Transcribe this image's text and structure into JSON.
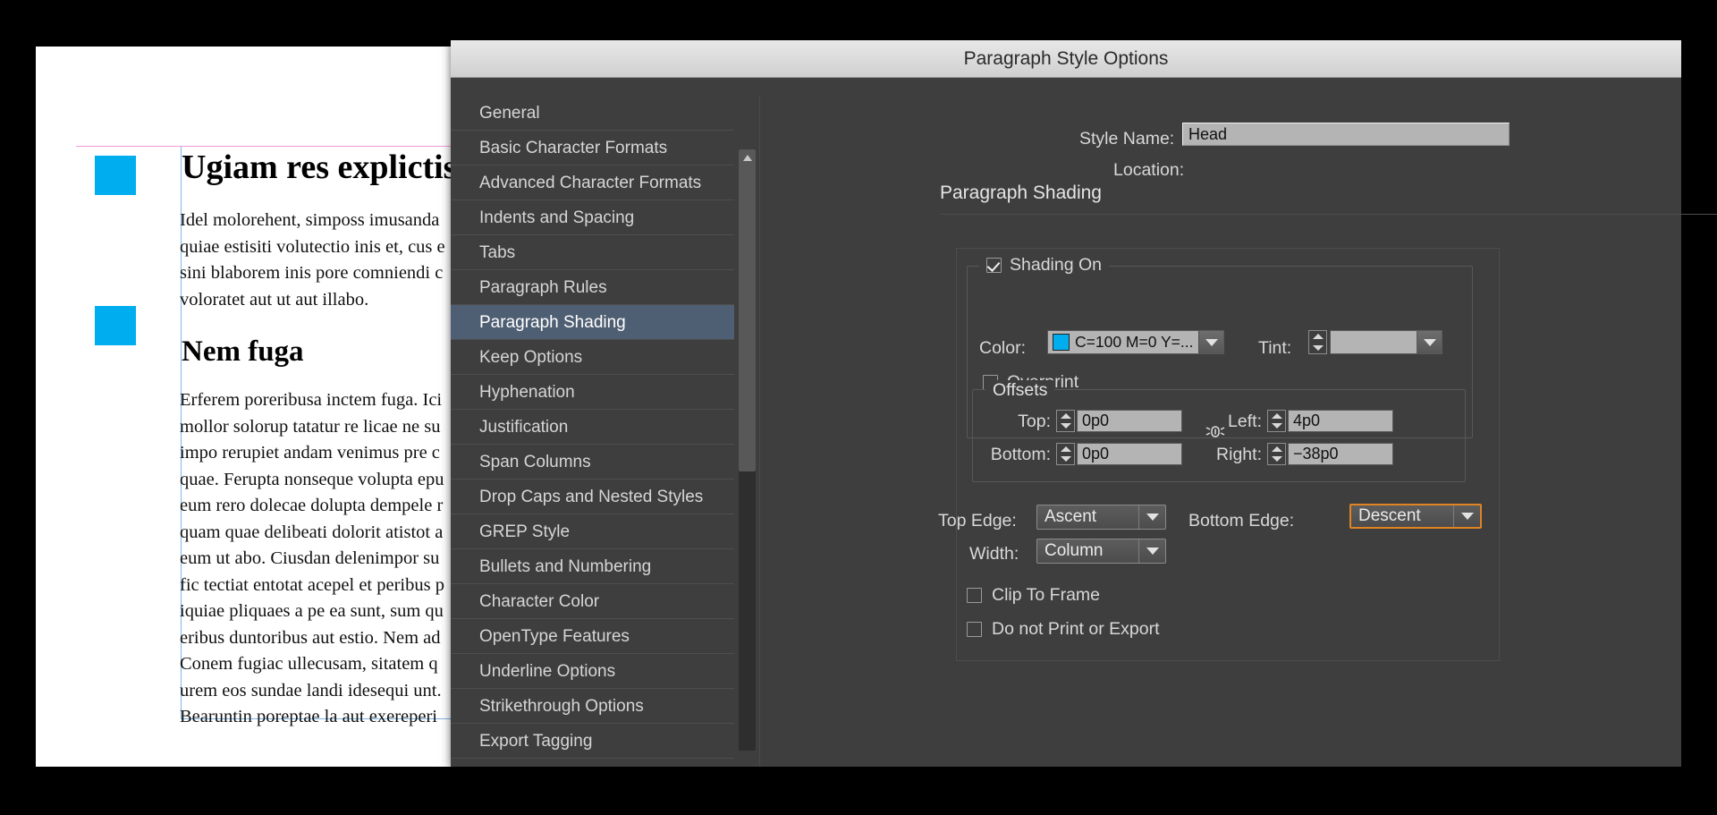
{
  "document": {
    "heading_1": "Ugiam res explictis",
    "heading_2": "Nem fuga",
    "body_1": "Idel molorehent, simposs imusanda\nquiae estisiti volutectio inis et, cus e\nsini blaborem inis pore comniendi c\nvoloratet aut ut aut illabo.",
    "body_2": "Erferem poreribusa inctem fuga. Ici\nmollor solorup tatatur re licae ne su\nimpo rerupiet andam venimus pre c\nquae. Ferupta nonseque volupta epu\neum rero dolecae dolupta dempele r\nquam quae delibeati dolorit atistot a\neum ut abo. Ciusdan delenimpor su\nfic tectiat entotat acepel et peribus p\niquiae pliquaes a pe ea sunt, sum qu\neribus duntoribus aut estio. Nem ad\nConem fugiac ullecusam, sitatem q\nurem eos sundae landi idesequi unt.\nBearuntin poreptae la aut exereperi"
  },
  "dialog": {
    "title": "Paragraph Style Options",
    "style_name_label": "Style Name:",
    "style_name_value": "Head",
    "location_label": "Location:",
    "section_title": "Paragraph Shading",
    "sidebar": {
      "items": [
        {
          "label": "General",
          "selected": false
        },
        {
          "label": "Basic Character Formats",
          "selected": false
        },
        {
          "label": "Advanced Character Formats",
          "selected": false
        },
        {
          "label": "Indents and Spacing",
          "selected": false
        },
        {
          "label": "Tabs",
          "selected": false
        },
        {
          "label": "Paragraph Rules",
          "selected": false
        },
        {
          "label": "Paragraph Shading",
          "selected": true
        },
        {
          "label": "Keep Options",
          "selected": false
        },
        {
          "label": "Hyphenation",
          "selected": false
        },
        {
          "label": "Justification",
          "selected": false
        },
        {
          "label": "Span Columns",
          "selected": false
        },
        {
          "label": "Drop Caps and Nested Styles",
          "selected": false
        },
        {
          "label": "GREP Style",
          "selected": false
        },
        {
          "label": "Bullets and Numbering",
          "selected": false
        },
        {
          "label": "Character Color",
          "selected": false
        },
        {
          "label": "OpenType Features",
          "selected": false
        },
        {
          "label": "Underline Options",
          "selected": false
        },
        {
          "label": "Strikethrough Options",
          "selected": false
        },
        {
          "label": "Export Tagging",
          "selected": false
        }
      ]
    },
    "shading": {
      "shading_on_label": "Shading On",
      "shading_on_checked": true,
      "color_label": "Color:",
      "color_value": "C=100 M=0 Y=...",
      "color_swatch_hex": "#00aeef",
      "tint_label": "Tint:",
      "tint_value": "",
      "overprint_label": "Overprint",
      "overprint_checked": false
    },
    "offsets": {
      "group_label": "Offsets",
      "top_label": "Top:",
      "top_value": "0p0",
      "bottom_label": "Bottom:",
      "bottom_value": "0p0",
      "left_label": "Left:",
      "left_value": "4p0",
      "right_label": "Right:",
      "right_value": "−38p0",
      "link_icon": "link-offsets-icon"
    },
    "edges": {
      "top_edge_label": "Top Edge:",
      "top_edge_value": "Ascent",
      "bottom_edge_label": "Bottom Edge:",
      "bottom_edge_value": "Descent",
      "bottom_edge_focused": true,
      "focus_color": "#e08423",
      "width_label": "Width:",
      "width_value": "Column"
    },
    "options": {
      "clip_to_frame_label": "Clip To Frame",
      "clip_to_frame_checked": false,
      "do_not_print_label": "Do not Print or Export",
      "do_not_print_checked": false
    }
  }
}
